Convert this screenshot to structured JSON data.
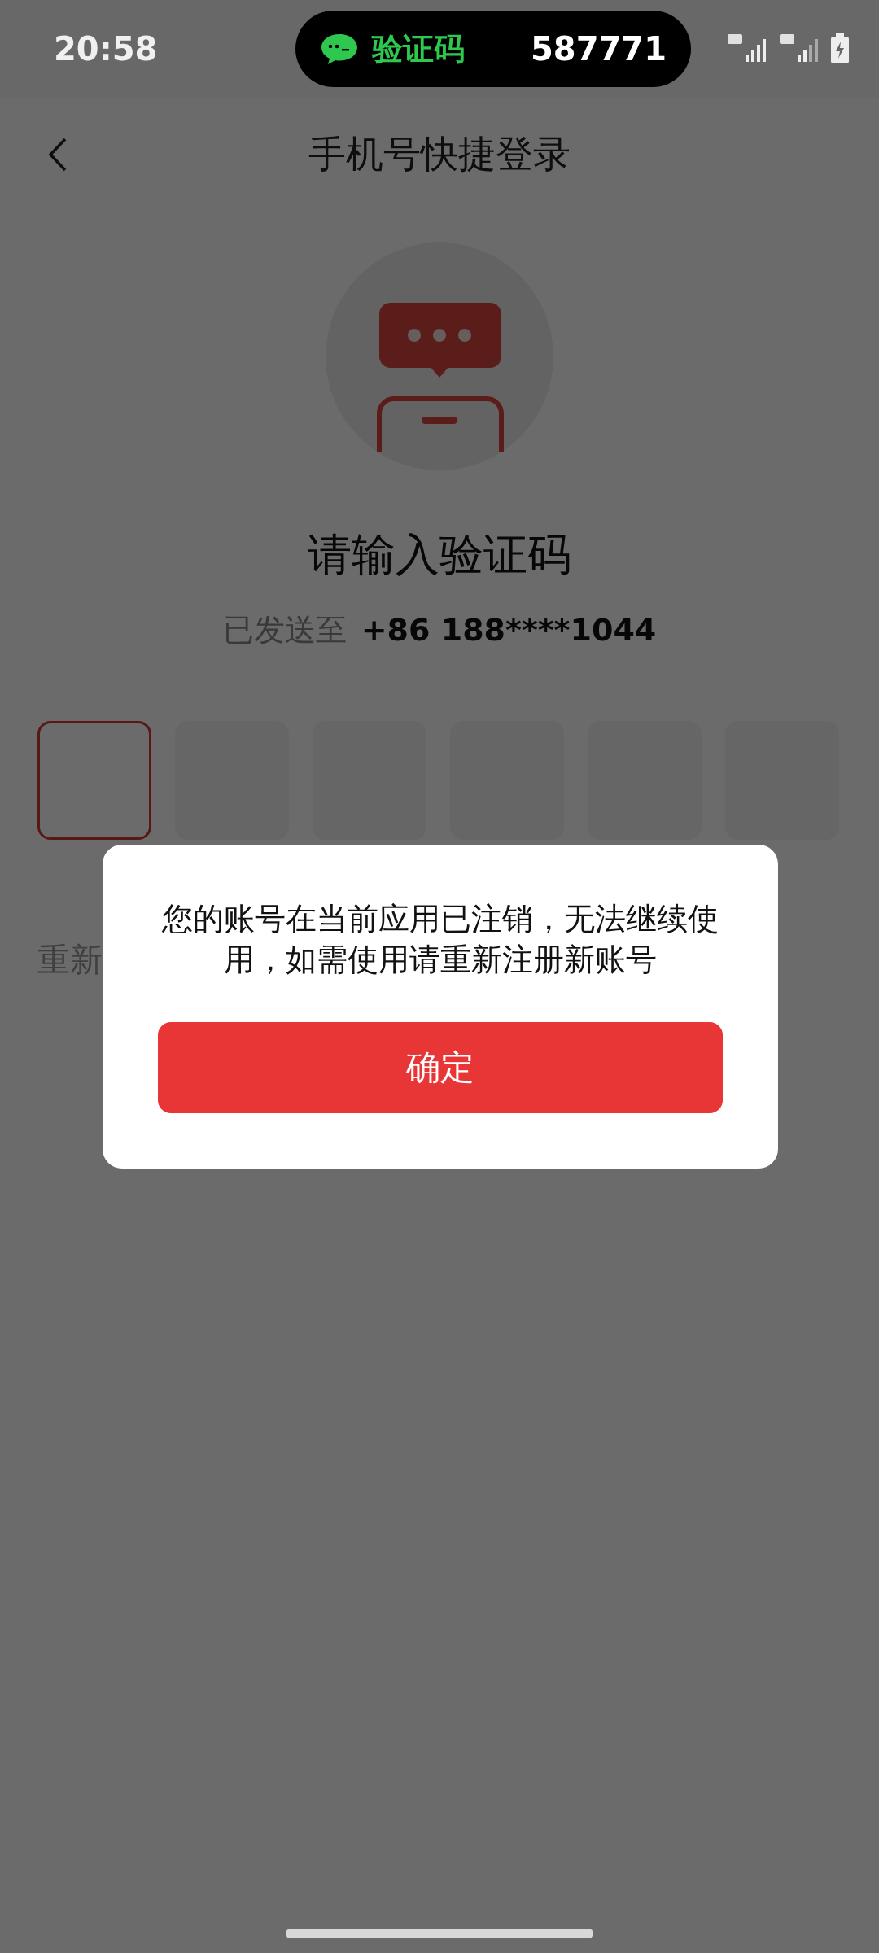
{
  "status_bar": {
    "time": "20:58",
    "notification": {
      "label": "验证码",
      "code": "587771"
    }
  },
  "header": {
    "title": "手机号快捷登录"
  },
  "heading": "请输入验证码",
  "sent_to": {
    "label": "已发送至",
    "phone": "+86 188****1044"
  },
  "code_boxes": [
    {
      "selected": true
    },
    {
      "selected": false
    },
    {
      "selected": false
    },
    {
      "selected": false
    },
    {
      "selected": false
    },
    {
      "selected": false
    }
  ],
  "resend": "重新",
  "dialog": {
    "message": "您的账号在当前应用已注销，无法继续使用，如需使用请重新注册新账号",
    "button": "确定"
  }
}
